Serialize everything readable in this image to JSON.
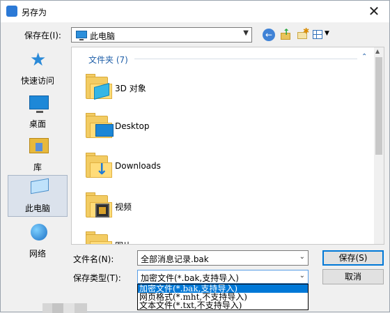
{
  "window": {
    "title": "另存为",
    "close_glyph": "✕"
  },
  "location": {
    "label": "保存在(I):",
    "value": "此电脑"
  },
  "toolbar": {
    "back_icon": "back-arrow-icon",
    "up_icon": "up-folder-icon",
    "new_folder_icon": "new-folder-icon",
    "views_icon": "view-menu-icon"
  },
  "places": [
    {
      "label": "快速访问",
      "icon": "quick-access-star-icon"
    },
    {
      "label": "桌面",
      "icon": "desktop-icon"
    },
    {
      "label": "库",
      "icon": "library-icon"
    },
    {
      "label": "此电脑",
      "icon": "this-pc-icon",
      "selected": true
    },
    {
      "label": "网络",
      "icon": "network-icon"
    }
  ],
  "file_list": {
    "group_header": "文件夹 (7)",
    "items": [
      {
        "name": "3D 对象",
        "icon": "3d-objects-folder-icon"
      },
      {
        "name": "Desktop",
        "icon": "desktop-folder-icon"
      },
      {
        "name": "Downloads",
        "icon": "downloads-folder-icon"
      },
      {
        "name": "视频",
        "icon": "videos-folder-icon"
      },
      {
        "name": "图片",
        "icon": "pictures-folder-icon"
      }
    ]
  },
  "filename": {
    "label": "文件名(N):",
    "value": "全部消息记录.bak"
  },
  "filetype": {
    "label": "保存类型(T):",
    "value": "加密文件(*.bak,支持导入)",
    "options": [
      {
        "label": "加密文件(*.bak,支持导入)",
        "selected": true
      },
      {
        "label": "网页格式(*.mht,不支持导入)"
      },
      {
        "label": "文本文件(*.txt,不支持导入)"
      }
    ]
  },
  "buttons": {
    "save": "保存(S)",
    "cancel": "取消"
  },
  "colors": {
    "accent": "#0078d7",
    "group_header": "#1e5ea8",
    "folder": "#f3cc63"
  }
}
